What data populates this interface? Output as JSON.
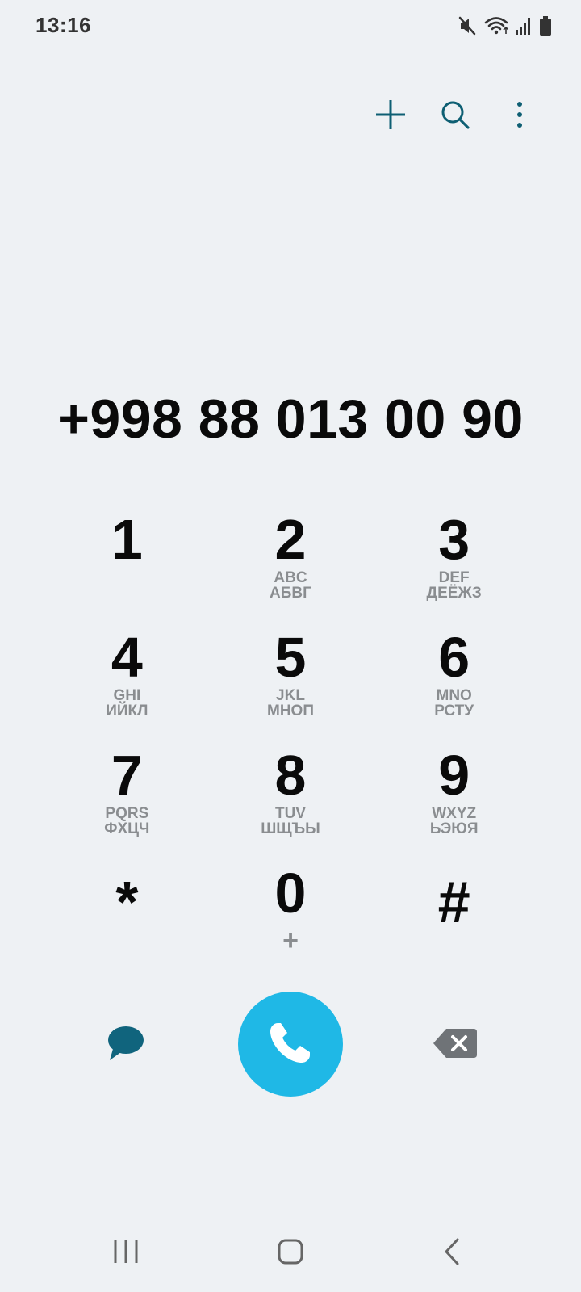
{
  "status_bar": {
    "time": "13:16",
    "icons": [
      "mute-icon",
      "wifi-icon",
      "signal-icon",
      "battery-icon"
    ]
  },
  "top_actions": {
    "icons": [
      "plus-icon",
      "search-icon",
      "more-vert-icon"
    ],
    "accent_color": "#0e5f73"
  },
  "dialer": {
    "number": "+998 88 013 00 90"
  },
  "keypad": {
    "keys": [
      {
        "digit": "1",
        "latin": "",
        "cyrillic": ""
      },
      {
        "digit": "2",
        "latin": "ABC",
        "cyrillic": "АБВГ"
      },
      {
        "digit": "3",
        "latin": "DEF",
        "cyrillic": "ДЕЁЖЗ"
      },
      {
        "digit": "4",
        "latin": "GHI",
        "cyrillic": "ИЙКЛ"
      },
      {
        "digit": "5",
        "latin": "JKL",
        "cyrillic": "МНОП"
      },
      {
        "digit": "6",
        "latin": "MNO",
        "cyrillic": "РСТУ"
      },
      {
        "digit": "7",
        "latin": "PQRS",
        "cyrillic": "ФХЦЧ"
      },
      {
        "digit": "8",
        "latin": "TUV",
        "cyrillic": "ШЩЪЫ"
      },
      {
        "digit": "9",
        "latin": "WXYZ",
        "cyrillic": "ЬЭЮЯ"
      }
    ],
    "star": "*",
    "zero": "0",
    "zero_sub": "+",
    "hash": "#"
  },
  "bottom_actions": {
    "message_icon": "message-icon",
    "call_icon": "phone-icon",
    "backspace_icon": "backspace-icon",
    "call_color": "#1fb8e6"
  },
  "nav_bar": {
    "icons": [
      "recents-icon",
      "home-icon",
      "back-icon"
    ]
  }
}
